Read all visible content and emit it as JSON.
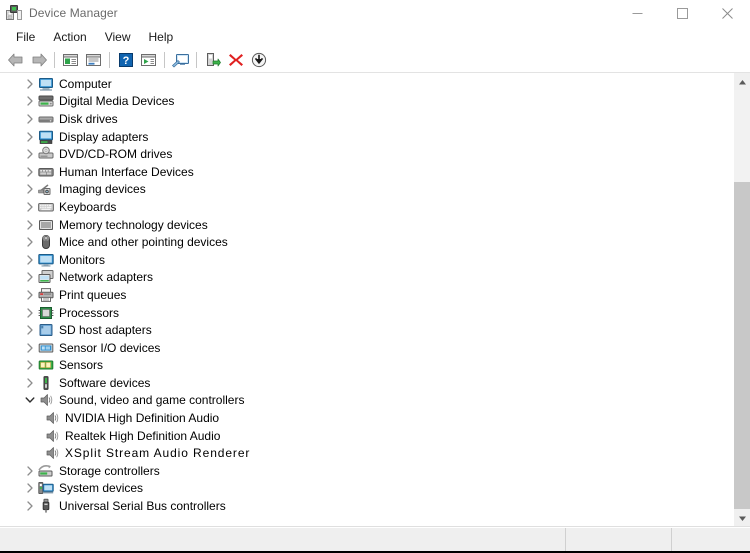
{
  "window": {
    "title": "Device Manager",
    "icon": "device-manager-icon",
    "caption": {
      "minimize": "minimize-icon",
      "maximize": "maximize-icon",
      "close": "close-icon"
    }
  },
  "menu": {
    "items": [
      {
        "label": "File"
      },
      {
        "label": "Action"
      },
      {
        "label": "View"
      },
      {
        "label": "Help"
      }
    ]
  },
  "toolbar": {
    "buttons": [
      {
        "name": "back-button",
        "icon": "back-arrow-icon"
      },
      {
        "name": "forward-button",
        "icon": "forward-arrow-icon"
      },
      {
        "name": "separator-1",
        "icon": "separator"
      },
      {
        "name": "properties-button",
        "icon": "properties-icon"
      },
      {
        "name": "show-hidden-button",
        "icon": "details-pane-icon"
      },
      {
        "name": "separator-2",
        "icon": "separator"
      },
      {
        "name": "help-button",
        "icon": "help-question-icon"
      },
      {
        "name": "view-button",
        "icon": "console-tree-icon"
      },
      {
        "name": "separator-3",
        "icon": "separator"
      },
      {
        "name": "scan-hardware-button",
        "icon": "monitor-scan-icon"
      },
      {
        "name": "separator-4",
        "icon": "separator"
      },
      {
        "name": "update-driver-button",
        "icon": "update-driver-icon"
      },
      {
        "name": "uninstall-device-button",
        "icon": "red-x-icon"
      },
      {
        "name": "disable-device-button",
        "icon": "down-arrow-circle-icon"
      }
    ]
  },
  "tree": {
    "nodes": [
      {
        "label": "Computer",
        "level": 1,
        "state": "collapsed",
        "icon": "computer-icon"
      },
      {
        "label": "Digital Media Devices",
        "level": 1,
        "state": "collapsed",
        "icon": "digital-media-icon"
      },
      {
        "label": "Disk drives",
        "level": 1,
        "state": "collapsed",
        "icon": "disk-drive-icon"
      },
      {
        "label": "Display adapters",
        "level": 1,
        "state": "collapsed",
        "icon": "display-adapter-icon"
      },
      {
        "label": "DVD/CD-ROM drives",
        "level": 1,
        "state": "collapsed",
        "icon": "dvd-drive-icon"
      },
      {
        "label": "Human Interface Devices",
        "level": 1,
        "state": "collapsed",
        "icon": "hid-icon"
      },
      {
        "label": "Imaging devices",
        "level": 1,
        "state": "collapsed",
        "icon": "imaging-icon"
      },
      {
        "label": "Keyboards",
        "level": 1,
        "state": "collapsed",
        "icon": "keyboard-icon"
      },
      {
        "label": "Memory technology devices",
        "level": 1,
        "state": "collapsed",
        "icon": "memory-icon"
      },
      {
        "label": "Mice and other pointing devices",
        "level": 1,
        "state": "collapsed",
        "icon": "mouse-icon"
      },
      {
        "label": "Monitors",
        "level": 1,
        "state": "collapsed",
        "icon": "monitor-icon"
      },
      {
        "label": "Network adapters",
        "level": 1,
        "state": "collapsed",
        "icon": "network-adapter-icon"
      },
      {
        "label": "Print queues",
        "level": 1,
        "state": "collapsed",
        "icon": "printer-icon"
      },
      {
        "label": "Processors",
        "level": 1,
        "state": "collapsed",
        "icon": "processor-icon"
      },
      {
        "label": "SD host adapters",
        "level": 1,
        "state": "collapsed",
        "icon": "sd-adapter-icon"
      },
      {
        "label": "Sensor I/O devices",
        "level": 1,
        "state": "collapsed",
        "icon": "sensor-io-icon"
      },
      {
        "label": "Sensors",
        "level": 1,
        "state": "collapsed",
        "icon": "sensors-icon"
      },
      {
        "label": "Software devices",
        "level": 1,
        "state": "collapsed",
        "icon": "software-device-icon"
      },
      {
        "label": "Sound, video and game controllers",
        "level": 1,
        "state": "expanded",
        "icon": "speaker-icon"
      },
      {
        "label": "NVIDIA High Definition Audio",
        "level": 2,
        "state": "leaf",
        "icon": "speaker-icon"
      },
      {
        "label": "Realtek High Definition Audio",
        "level": 2,
        "state": "leaf",
        "icon": "speaker-icon"
      },
      {
        "label": "XSplit Stream Audio Renderer",
        "level": 2,
        "state": "leaf",
        "icon": "speaker-icon",
        "spaced": true
      },
      {
        "label": "Storage controllers",
        "level": 1,
        "state": "collapsed",
        "icon": "storage-controller-icon"
      },
      {
        "label": "System devices",
        "level": 1,
        "state": "collapsed",
        "icon": "system-device-icon"
      },
      {
        "label": "Universal Serial Bus controllers",
        "level": 1,
        "state": "collapsed",
        "icon": "usb-icon"
      }
    ]
  },
  "scrollbar": {
    "up_arrow": "scroll-up-arrow-icon",
    "down_arrow": "scroll-down-arrow-icon"
  },
  "statusbar": {
    "cell1": "",
    "cell2": "",
    "cell3": ""
  }
}
